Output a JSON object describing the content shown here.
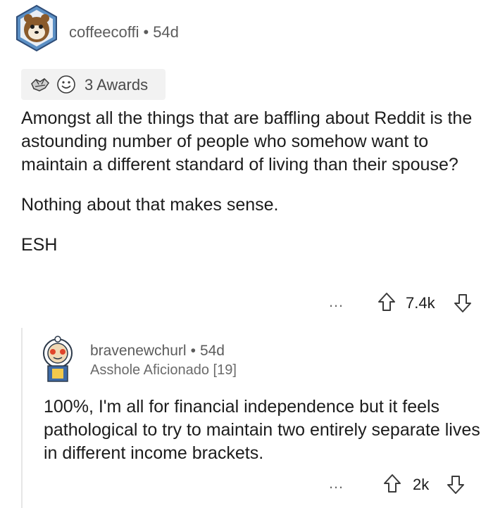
{
  "comment": {
    "username": "coffeecoffi",
    "age": "54d",
    "awards_label": "3 Awards",
    "paragraphs": [
      "Amongst all the things that are baffling about Reddit is the astounding number of people who somehow want to maintain a different standard of living than their spouse?",
      "Nothing about that makes sense.",
      "ESH"
    ],
    "more_label": "…",
    "score": "7.4k"
  },
  "reply": {
    "username": "bravenewchurl",
    "age": "54d",
    "flair": "Asshole Aficionado [19]",
    "text": "100%, I'm all for financial independence but it feels pathological to try to maintain two entirely separate lives in different income brackets.",
    "more_label": "…",
    "score": "2k"
  },
  "separator": "•"
}
